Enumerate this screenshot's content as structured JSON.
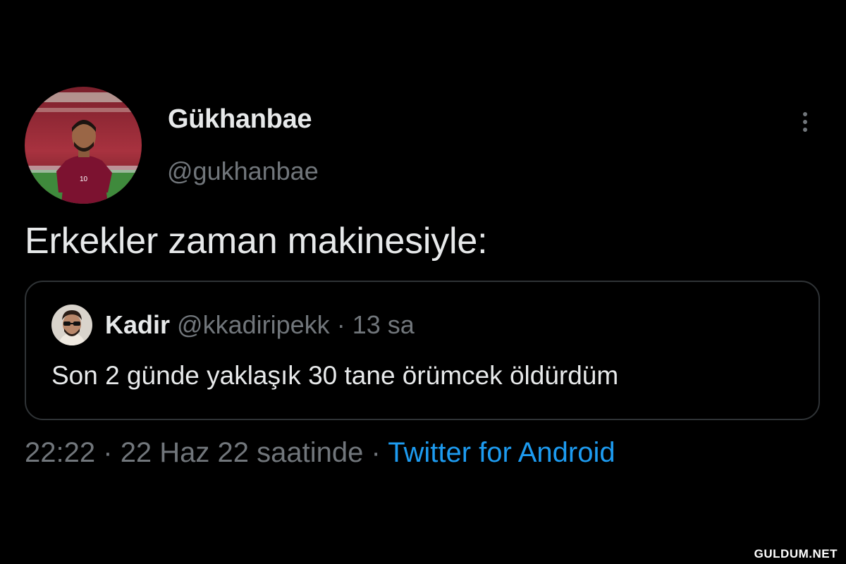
{
  "author": {
    "display_name": "Gükhanbae",
    "handle": "@gukhanbae",
    "avatar": "avatar-photo-football-player"
  },
  "more_icon": "kebab-more-icon",
  "tweet": {
    "text": "Erkekler zaman makinesiyle:"
  },
  "quoted_tweet": {
    "display_name": "Kadir",
    "handle": "@kkadiripekk",
    "separator": "·",
    "time": "13 sa",
    "text": "Son 2 günde yaklaşık 30 tane örümcek öldürdüm",
    "avatar": "avatar-photo-man-sunglasses"
  },
  "meta": {
    "time": "22:22",
    "separator": "·",
    "date": "22 Haz 22 saatinde",
    "source": "Twitter for Android"
  },
  "watermark": "GULDUM.NET",
  "colors": {
    "background": "#000000",
    "primary_text": "#e7e9ea",
    "secondary_text": "#71767b",
    "link": "#1d9bf0",
    "border": "#2f3336"
  }
}
